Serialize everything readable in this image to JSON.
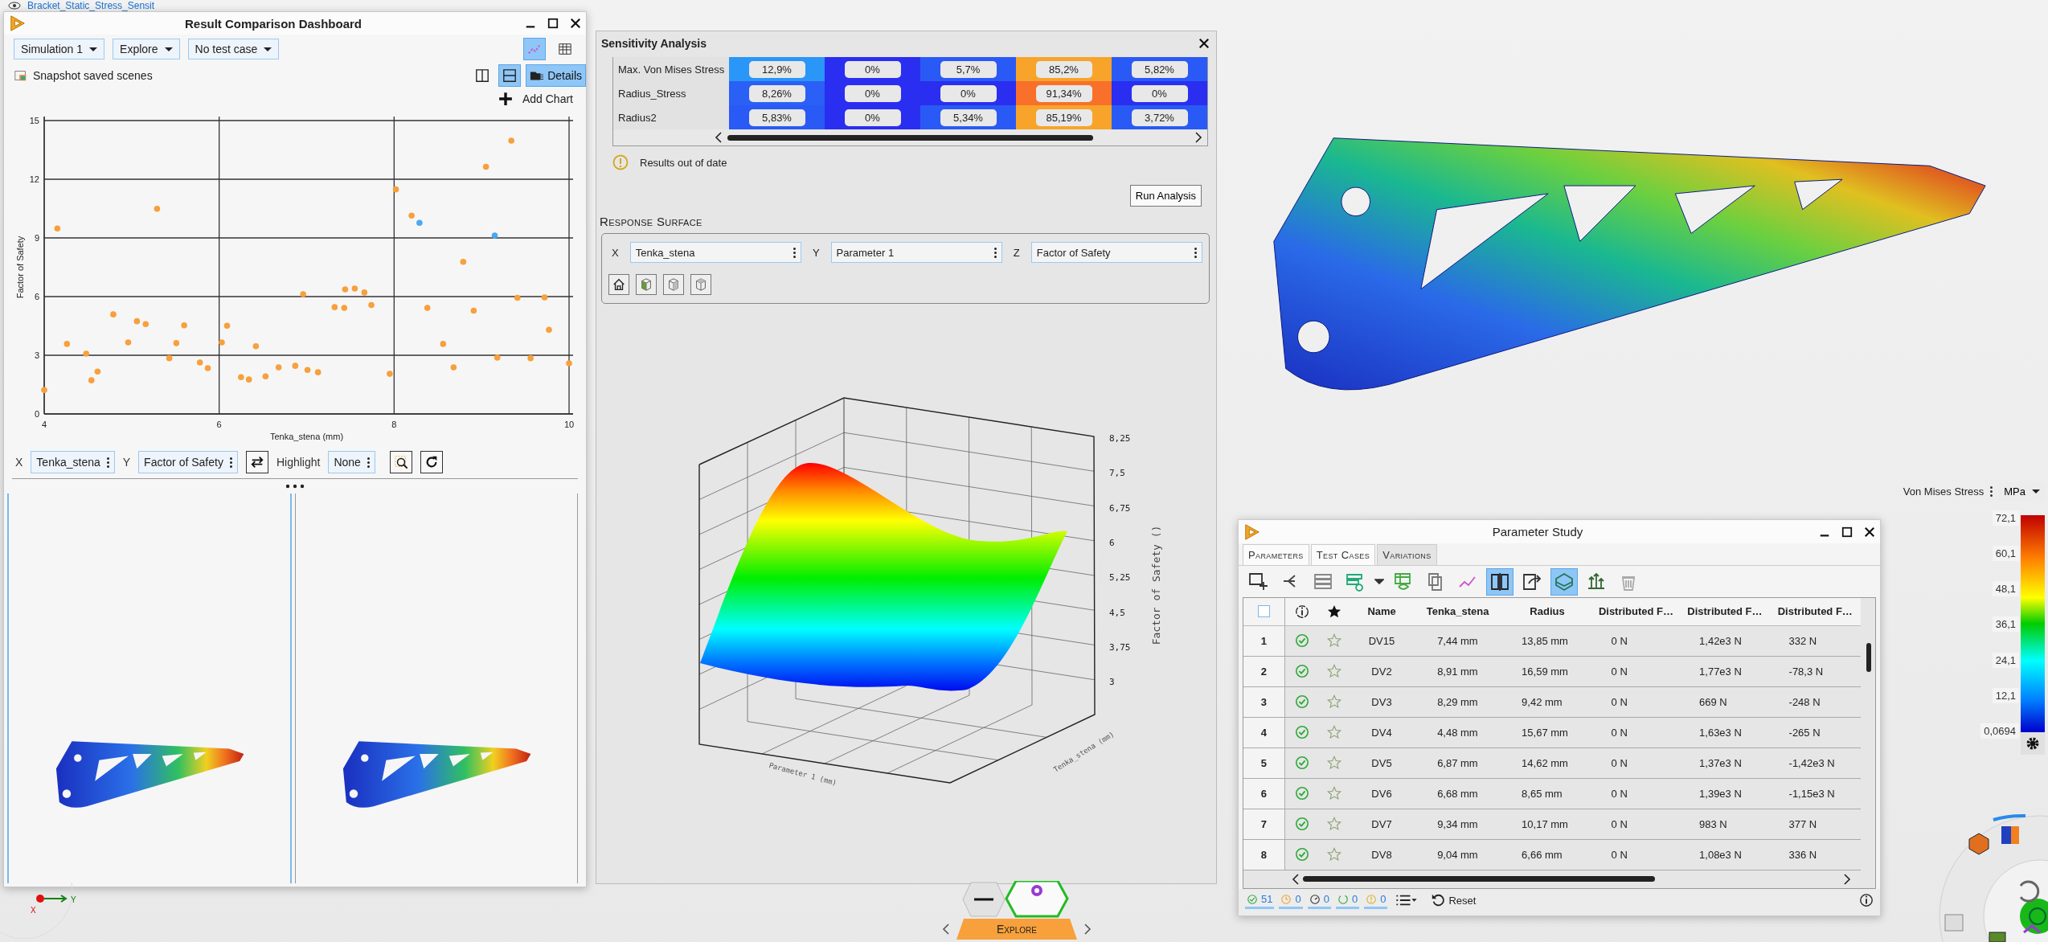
{
  "top_tab": {
    "title": "Bracket_Static_Stress_Sensit"
  },
  "dashboard": {
    "title": "Result Comparison Dashboard",
    "dropdowns": [
      "Simulation 1",
      "Explore",
      "No test case"
    ],
    "view_toggles": [
      {
        "kind": "chart",
        "selected": true
      },
      {
        "kind": "table",
        "selected": false
      }
    ],
    "snapshot_label": "Snapshot saved scenes",
    "layout_toggles": [
      {
        "kind": "columns",
        "selected": false
      },
      {
        "kind": "rows",
        "selected": true
      },
      {
        "kind": "details",
        "label": "Details",
        "selected": true
      }
    ],
    "add_chart": "Add Chart",
    "chart_data": {
      "type": "scatter",
      "grid": true,
      "xlabel": "Tenka_stena (mm)",
      "ylabel": "Factor of Safety",
      "xlim": [
        4,
        10
      ],
      "ylim": [
        0,
        15
      ],
      "xticks": [
        4,
        6,
        8,
        10
      ],
      "yticks": [
        0,
        3,
        6,
        9,
        12,
        15
      ],
      "x": [
        4.0,
        4.15,
        4.26,
        4.48,
        4.54,
        4.61,
        4.79,
        4.96,
        5.06,
        5.16,
        5.29,
        5.43,
        5.51,
        5.6,
        5.78,
        5.87,
        6.03,
        6.09,
        6.25,
        6.34,
        6.42,
        6.53,
        6.68,
        6.87,
        6.96,
        7.01,
        7.13,
        7.32,
        7.43,
        7.44,
        7.55,
        7.66,
        7.74,
        7.95,
        8.02,
        8.2,
        8.29,
        8.38,
        8.56,
        8.68,
        8.79,
        8.91,
        9.05,
        9.15,
        9.18,
        9.34,
        9.41,
        9.56,
        9.72,
        9.77,
        10.0
      ],
      "series": [
        {
          "color": "#f7a03c",
          "values": [
            1.22,
            9.48,
            3.58,
            3.08,
            1.72,
            2.17,
            5.09,
            3.66,
            4.74,
            4.59,
            10.49,
            2.85,
            3.62,
            4.53,
            2.63,
            2.34,
            3.66,
            4.51,
            1.88,
            1.76,
            3.46,
            1.92,
            2.38,
            2.46,
            6.12,
            2.25,
            2.13,
            5.46,
            5.42,
            6.37,
            6.41,
            6.21,
            5.57,
            2.05,
            11.48,
            10.14,
            null,
            5.42,
            3.58,
            2.38,
            7.78,
            5.28,
            12.64,
            null,
            2.88,
            13.97,
            5.94,
            2.85,
            5.96,
            4.3,
            2.59
          ]
        },
        {
          "color": "#4aa8f0",
          "values": [
            null,
            null,
            null,
            null,
            null,
            null,
            null,
            null,
            null,
            null,
            null,
            null,
            null,
            null,
            null,
            null,
            null,
            null,
            null,
            null,
            null,
            null,
            null,
            null,
            null,
            null,
            null,
            null,
            null,
            null,
            null,
            null,
            null,
            null,
            null,
            null,
            9.77,
            null,
            null,
            null,
            null,
            null,
            null,
            9.12,
            null,
            null,
            null,
            null,
            null,
            null,
            null
          ]
        }
      ]
    },
    "axis_controls": [
      {
        "kind": "field",
        "label": "X",
        "value": "Tenka_stena"
      },
      {
        "kind": "field",
        "label": "Y",
        "value": "Factor of Safety"
      },
      {
        "kind": "swap"
      },
      {
        "kind": "field",
        "label": "Highlight",
        "value": "None"
      },
      {
        "kind": "zoom"
      },
      {
        "kind": "refresh"
      }
    ]
  },
  "sensitivity": {
    "title": "Sensitivity Analysis",
    "rows": [
      {
        "name": "Max. Von Mises Stress",
        "cells": [
          {
            "value": "12,9%",
            "color": "#2a96f8"
          },
          {
            "value": "0%",
            "color": "#2a2ef0"
          },
          {
            "value": "5,7%",
            "color": "#2a5af5"
          },
          {
            "value": "85,2%",
            "color": "#f8a42a"
          },
          {
            "value": "5,82%",
            "color": "#2a5af5"
          }
        ]
      },
      {
        "name": "Radius_Stress",
        "cells": [
          {
            "value": "8,26%",
            "color": "#2a60f5"
          },
          {
            "value": "0%",
            "color": "#2a2ef0"
          },
          {
            "value": "0%",
            "color": "#2a2ef0"
          },
          {
            "value": "91,34%",
            "color": "#f8702a"
          },
          {
            "value": "0%",
            "color": "#2a2ef0"
          }
        ]
      },
      {
        "name": "Radius2",
        "cells": [
          {
            "value": "5,83%",
            "color": "#2a5af5"
          },
          {
            "value": "0%",
            "color": "#2a2ef0"
          },
          {
            "value": "5,34%",
            "color": "#2a5af5"
          },
          {
            "value": "85,19%",
            "color": "#f8a42a"
          },
          {
            "value": "3,72%",
            "color": "#2a5af5"
          }
        ]
      }
    ],
    "warning": "Results out of date",
    "run_button": "Run Analysis",
    "section_title": "Response Surface",
    "axes": [
      {
        "label": "X",
        "value": "Tenka_stena"
      },
      {
        "label": "Y",
        "value": "Parameter 1"
      },
      {
        "label": "Z",
        "value": "Factor of Safety"
      }
    ],
    "view_buttons": [
      {
        "kind": "home"
      },
      {
        "kind": "front"
      },
      {
        "kind": "side"
      },
      {
        "kind": "top"
      }
    ],
    "surface": {
      "z_ticks": [
        "8,25",
        "7,5",
        "6,75",
        "6",
        "5,25",
        "4,5",
        "3,75",
        "3"
      ],
      "z_title": "Factor of Safety ()",
      "x_title": "Parameter 1 (mm)",
      "y_title": "Tenka_stena (mm)"
    }
  },
  "legend": {
    "quantity": "Von Mises Stress",
    "unit": "MPa",
    "ticks": [
      "72,1",
      "60,1",
      "48,1",
      "36,1",
      "24,1",
      "12,1",
      "0,0694"
    ]
  },
  "parameter_study": {
    "title": "Parameter Study",
    "tabs": [
      {
        "label": "Parameters",
        "selected": false
      },
      {
        "label": "Test Cases",
        "selected": false
      },
      {
        "label": "Variations",
        "selected": true
      }
    ],
    "toolbar": [
      {
        "kind": "add",
        "selected": false
      },
      {
        "kind": "branch",
        "selected": false
      },
      {
        "kind": "rows",
        "selected": false
      },
      {
        "kind": "rowcheck",
        "selected": false
      },
      {
        "kind": "caret",
        "selected": false
      },
      {
        "kind": "tableview",
        "selected": false
      },
      {
        "kind": "copy",
        "selected": false
      },
      {
        "kind": "linechart",
        "selected": false
      },
      {
        "kind": "split",
        "selected": true
      },
      {
        "kind": "export",
        "selected": false
      },
      {
        "kind": "surface",
        "selected": true
      },
      {
        "kind": "arrows",
        "selected": false
      },
      {
        "kind": "trash",
        "selected": false
      }
    ],
    "all_selected": false,
    "columns": [
      "Name",
      "Tenka_stena",
      "Radius",
      "Distributed F…",
      "Distributed F…",
      "Distributed F…"
    ],
    "rows": [
      {
        "index": "1",
        "ok": true,
        "starred": false,
        "cells": [
          "DV15",
          "7,44 mm",
          "13,85 mm",
          "0 N",
          "1,42e3 N",
          "332 N"
        ]
      },
      {
        "index": "2",
        "ok": true,
        "starred": false,
        "cells": [
          "DV2",
          "8,91 mm",
          "16,59 mm",
          "0 N",
          "1,77e3 N",
          "-78,3 N"
        ]
      },
      {
        "index": "3",
        "ok": true,
        "starred": false,
        "cells": [
          "DV3",
          "8,29 mm",
          "9,42 mm",
          "0 N",
          "669 N",
          "-248 N"
        ]
      },
      {
        "index": "4",
        "ok": true,
        "starred": false,
        "cells": [
          "DV4",
          "4,48 mm",
          "15,67 mm",
          "0 N",
          "1,63e3 N",
          "-265 N"
        ]
      },
      {
        "index": "5",
        "ok": true,
        "starred": false,
        "cells": [
          "DV5",
          "6,87 mm",
          "14,62 mm",
          "0 N",
          "1,37e3 N",
          "-1,42e3 N"
        ]
      },
      {
        "index": "6",
        "ok": true,
        "starred": false,
        "cells": [
          "DV6",
          "6,68 mm",
          "8,65 mm",
          "0 N",
          "1,39e3 N",
          "-1,15e3 N"
        ]
      },
      {
        "index": "7",
        "ok": true,
        "starred": false,
        "cells": [
          "DV7",
          "9,34 mm",
          "10,17 mm",
          "0 N",
          "983 N",
          "377 N"
        ]
      },
      {
        "index": "8",
        "ok": true,
        "starred": false,
        "cells": [
          "DV8",
          "9,04 mm",
          "6,66 mm",
          "0 N",
          "1,08e3 N",
          "336 N"
        ]
      }
    ],
    "status": [
      {
        "kind": "done",
        "count": "51"
      },
      {
        "kind": "queued",
        "count": "0"
      },
      {
        "kind": "running",
        "count": "0"
      },
      {
        "kind": "loading",
        "count": "0"
      },
      {
        "kind": "warning",
        "count": "0"
      }
    ],
    "reset": "Reset"
  },
  "triad": {
    "x": "X",
    "y": "Y"
  },
  "mode_tab": {
    "label": "Explore"
  }
}
